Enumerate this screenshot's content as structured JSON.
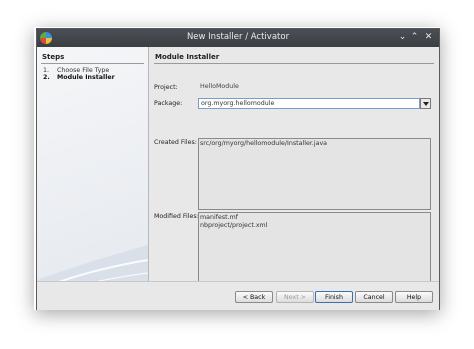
{
  "window": {
    "title": "New Installer / Activator"
  },
  "steps": {
    "heading": "Steps",
    "items": [
      {
        "num": "1.",
        "label": "Choose File Type"
      },
      {
        "num": "2.",
        "label": "Module Installer"
      }
    ]
  },
  "main": {
    "heading": "Module Installer",
    "project_label": "Project:",
    "project_value": "HelloModule",
    "package_label": "Package:",
    "package_value": "org.myorg.hellomodule",
    "created_label": "Created Files:",
    "created_files": [
      "src/org/myorg/hellomodule/Installer.java"
    ],
    "modified_label": "Modified Files:",
    "modified_files": [
      "manifest.mf",
      "nbproject/project.xml"
    ]
  },
  "buttons": {
    "back": "< Back",
    "next": "Next >",
    "finish": "Finish",
    "cancel": "Cancel",
    "help": "Help"
  }
}
